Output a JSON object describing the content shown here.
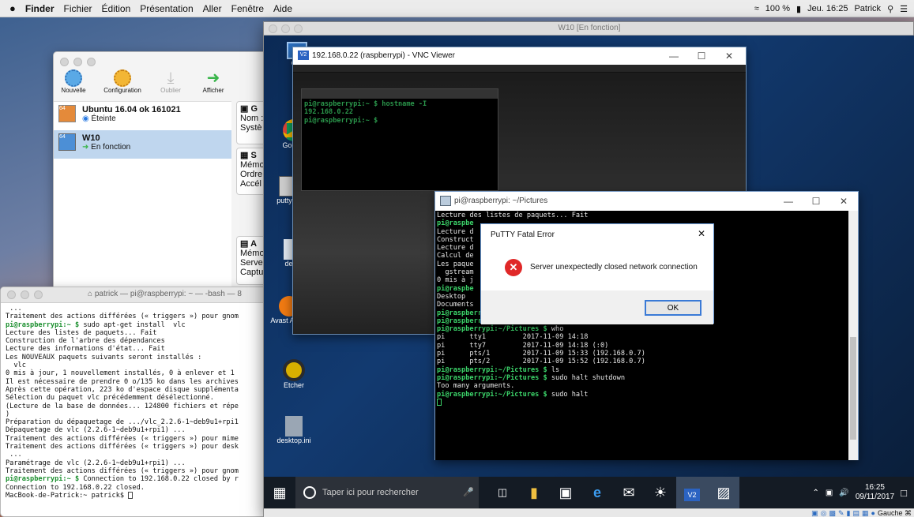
{
  "menubar": {
    "apple": "",
    "items": [
      "Finder",
      "Fichier",
      "Édition",
      "Présentation",
      "Aller",
      "Fenêtre",
      "Aide"
    ],
    "battery": "100 %",
    "clock": "Jeu. 16:25",
    "user": "Patrick"
  },
  "vbox": {
    "toolbar": [
      {
        "label": "Nouvelle",
        "icon": "sun-icon"
      },
      {
        "label": "Configuration",
        "icon": "gear-icon"
      },
      {
        "label": "Oublier",
        "icon": "arrow-down-icon"
      },
      {
        "label": "Afficher",
        "icon": "arrow-right-icon"
      }
    ],
    "vms": [
      {
        "name": "Ubuntu 16.04 ok 161021",
        "status": "Éteinte",
        "badge": "64"
      },
      {
        "name": "W10",
        "status": "En fonction",
        "badge": "64"
      }
    ],
    "details": {
      "g_title": "G",
      "g_lines": [
        "Nom :",
        "Systè"
      ],
      "s_title": "S",
      "s_lines": [
        "Mémo",
        "Ordre",
        "Accél"
      ],
      "a_title": "A",
      "a_lines": [
        "Mémo",
        "Serve",
        "Captu"
      ]
    }
  },
  "vm_window": {
    "title": "W10 [En fonction]"
  },
  "win_desktop_icons": [
    {
      "label": "Cor",
      "icon": "computer-icon"
    },
    {
      "label": "Google",
      "icon": "chrome-icon"
    },
    {
      "label": "putty-6",
      "icon": "putty-icon"
    },
    {
      "label": "desk",
      "icon": "file-icon"
    },
    {
      "label": "Avast A Gra",
      "icon": "avast-icon"
    },
    {
      "label": "Etcher",
      "icon": "etcher-icon"
    },
    {
      "label": "desktop.ini",
      "icon": "file-icon"
    }
  ],
  "vnc": {
    "title": "192.168.0.22 (raspberrypi) - VNC Viewer",
    "inner_term": [
      "pi@raspberrypi:~ $ hostname -I",
      "192.168.0.22",
      "pi@raspberrypi:~ $ "
    ]
  },
  "putty": {
    "title": "pi@raspberrypi: ~/Pictures",
    "lines": [
      {
        "p": "",
        "t": "Lecture des listes de paquets... Fait"
      },
      {
        "p": "pi@raspbe",
        "t": ""
      },
      {
        "p": "",
        "t": "Lecture d"
      },
      {
        "p": "",
        "t": "Construct"
      },
      {
        "p": "",
        "t": "Lecture d"
      },
      {
        "p": "",
        "t": "Calcul de"
      },
      {
        "p": "",
        "t": "Les paque"
      },
      {
        "p": "",
        "t": "  gstream"
      },
      {
        "p": "",
        "t": "0 mis à j                                    1 non mis à jour."
      },
      {
        "p": "pi@raspbe",
        "t": ""
      },
      {
        "p": "",
        "t": "Desktop"
      },
      {
        "p": "",
        "t": "Documents"
      },
      {
        "p": "pi@raspberrypi:~ $ ",
        "t": "cd Pictures"
      },
      {
        "p": "pi@raspberrypi:~/Pictures $ ",
        "t": "ls"
      },
      {
        "p": "pi@raspberrypi:~/Pictures $ ",
        "t": "who"
      },
      {
        "p": "",
        "t": "pi      tty1         2017-11-09 14:18"
      },
      {
        "p": "",
        "t": "pi      tty7         2017-11-09 14:18 (:0)"
      },
      {
        "p": "",
        "t": "pi      pts/1        2017-11-09 15:33 (192.168.0.7)"
      },
      {
        "p": "",
        "t": "pi      pts/2        2017-11-09 15:52 (192.168.0.7)"
      },
      {
        "p": "pi@raspberrypi:~/Pictures $ ",
        "t": "ls"
      },
      {
        "p": "pi@raspberrypi:~/Pictures $ ",
        "t": "sudo halt shutdown"
      },
      {
        "p": "",
        "t": "Too many arguments."
      },
      {
        "p": "pi@raspberrypi:~/Pictures $ ",
        "t": "sudo halt"
      }
    ]
  },
  "error_dialog": {
    "title": "PuTTY Fatal Error",
    "message": "Server unexpectedly closed network connection",
    "ok": "OK"
  },
  "mac_terminal": {
    "title": "patrick — pi@raspberrypi: ~ — -bash — 8",
    "lines": [
      {
        "p": "",
        "t": " ..."
      },
      {
        "p": "",
        "t": "Traitement des actions différées (« triggers ») pour gnom"
      },
      {
        "p": "pi@raspberrypi:~ $ ",
        "t": "sudo apt-get install  vlc"
      },
      {
        "p": "",
        "t": "Lecture des listes de paquets... Fait"
      },
      {
        "p": "",
        "t": "Construction de l'arbre des dépendances"
      },
      {
        "p": "",
        "t": "Lecture des informations d'état... Fait"
      },
      {
        "p": "",
        "t": "Les NOUVEAUX paquets suivants seront installés :"
      },
      {
        "p": "",
        "t": "  vlc"
      },
      {
        "p": "",
        "t": "0 mis à jour, 1 nouvellement installés, 0 à enlever et 1"
      },
      {
        "p": "",
        "t": "Il est nécessaire de prendre 0 o/135 ko dans les archives"
      },
      {
        "p": "",
        "t": "Après cette opération, 223 ko d'espace disque supplémenta"
      },
      {
        "p": "",
        "t": "Sélection du paquet vlc précédemment désélectionné."
      },
      {
        "p": "",
        "t": "(Lecture de la base de données... 124800 fichiers et répe"
      },
      {
        "p": "",
        "t": ")"
      },
      {
        "p": "",
        "t": "Préparation du dépaquetage de .../vlc_2.2.6-1~deb9u1+rpi1"
      },
      {
        "p": "",
        "t": "Dépaquetage de vlc (2.2.6-1~deb9u1+rpi1) ..."
      },
      {
        "p": "",
        "t": "Traitement des actions différées (« triggers ») pour mime"
      },
      {
        "p": "",
        "t": "Traitement des actions différées (« triggers ») pour desk"
      },
      {
        "p": "",
        "t": " ..."
      },
      {
        "p": "",
        "t": "Paramétrage de vlc (2.2.6-1~deb9u1+rpi1) ..."
      },
      {
        "p": "",
        "t": "Traitement des actions différées (« triggers ») pour gnom"
      },
      {
        "p": "pi@raspberrypi:~ $ ",
        "t": "Connection to 192.168.0.22 closed by r"
      },
      {
        "p": "",
        "t": "Connection to 192.168.0.22 closed."
      },
      {
        "p": "",
        "t": "MacBook-de-Patrick:~ patrick$ "
      }
    ]
  },
  "taskbar": {
    "search_placeholder": "Taper ici pour rechercher",
    "time": "16:25",
    "date": "09/11/2017",
    "host_key": "Gauche ⌘"
  }
}
